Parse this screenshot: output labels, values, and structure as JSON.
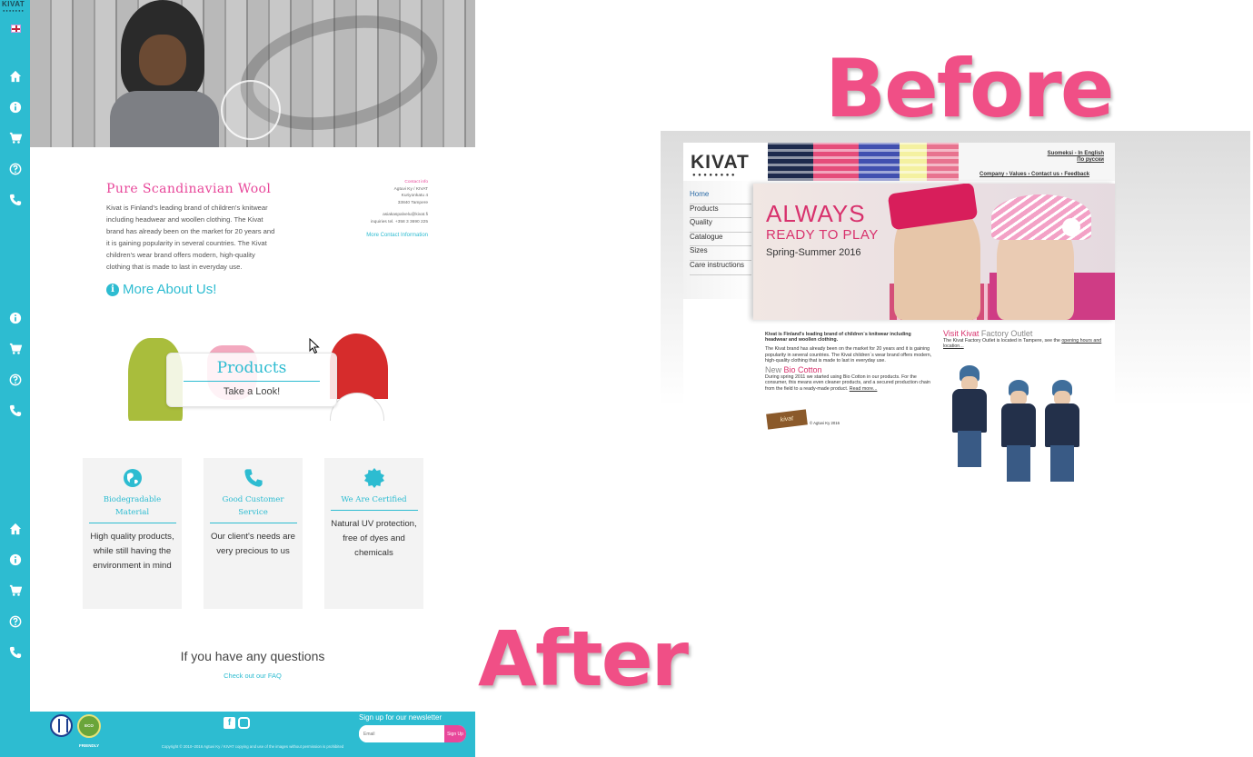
{
  "labels": {
    "before": "Before",
    "after": "After"
  },
  "after_site": {
    "sidebar": {
      "logo": "KIVAT",
      "logo_dots": "●●●●●●●",
      "icons_group1": [
        "home-icon",
        "info-icon",
        "cart-icon",
        "help-icon",
        "phone-icon"
      ],
      "icons_group2": [
        "info-icon",
        "cart-icon",
        "help-icon",
        "phone-icon"
      ],
      "icons_group3": [
        "home-icon",
        "info-icon",
        "cart-icon",
        "help-icon",
        "phone-icon"
      ]
    },
    "intro": {
      "title": "Pure Scandinavian Wool",
      "text": "Kivat is Finland's leading brand of children's knitwear including headwear and woollen clothing. The Kivat brand has already been on the market for 20 years and it is gaining popularity in several countries. The Kivat children's wear brand offers modern, high-quality clothing that is made to last in everyday use.",
      "more_about": "More About Us!"
    },
    "contact": {
      "heading": "Contact info",
      "line1": "Agtuvi Ky / KIVAT",
      "line2": "Kuriyonkatu 4",
      "line3": "33840 Tampere",
      "email": "asiakaspalvelu@kivat.fi",
      "phone": "inquiries tel. +358 3 3690 225",
      "more": "More Contact Information"
    },
    "products": {
      "title": "Products",
      "subtitle": "Take a Look!"
    },
    "features": [
      {
        "icon": "globe-icon",
        "title": "Biodegradable Material",
        "text": "High quality products, while still having the environment in mind"
      },
      {
        "icon": "phone-icon",
        "title": "Good Customer Service",
        "text": "Our client's needs are very precious to us"
      },
      {
        "icon": "badge-icon",
        "title": "We Are Certified",
        "text": "Natural UV protection, free of dyes and chemicals"
      }
    ],
    "questions": "If you have any questions",
    "faq_link": "Check out our FAQ",
    "footer": {
      "badge2": "ECO FRIENDLY",
      "newsletter_label": "Sign up for our newsletter",
      "email_placeholder": "Email",
      "signup": "Sign Up",
      "copyright": "Copyright © 2010–2016 Agtuvi Ky / KIVAT copying and use of the images without permission is prohibited"
    }
  },
  "before_site": {
    "logo": "KIVAT",
    "logo_dots": "●●●●●●●●",
    "lang1": "Suomeksi - In English",
    "lang2": "По русски",
    "topnav": "Company › Values › Contact us › Feedback",
    "nav": [
      "Home",
      "Products",
      "Quality",
      "Catalogue",
      "Sizes",
      "Care instructions"
    ],
    "hero": {
      "line1": "ALWAYS",
      "line2": "READY TO PLAY",
      "line3": "Spring-Summer 2016"
    },
    "lead": "Kivat is Finland's leading brand of children´s knitwear including headwear and woollen clothing.",
    "para1": "The Kivat brand has already been on the market for 20 years and it is gaining popularity in several countries. The Kivat children´s wear brand offers modern, high-quality clothing that is made to last in everyday use.",
    "new_label": "New",
    "bio_label": "Bio Cotton",
    "para2": "During spring 2011 we started using Bio Cotton in our products. For the consumer, this means even cleaner products, and a secured production chain from the field to a ready-made product.",
    "read_more": "Read more...",
    "signature": "kivat",
    "copyright": "© Agtuvi Ky 2016",
    "visit_pink": "Visit Kivat",
    "visit_grey": "Factory Outlet",
    "outlet_text": "The Kivat Factory Outlet is located in Tampere, see the",
    "outlet_link": "opening hours and location..."
  }
}
